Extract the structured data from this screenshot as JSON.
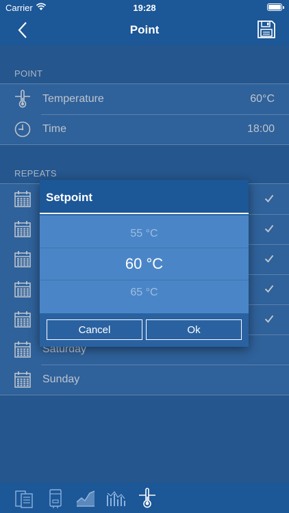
{
  "status_bar": {
    "carrier": "Carrier",
    "time": "19:28"
  },
  "nav": {
    "title": "Point",
    "back_icon": "chevron-left-icon",
    "save_icon": "floppy-disk-icon"
  },
  "point_section": {
    "header": "POINT",
    "rows": [
      {
        "label": "Temperature",
        "value": "60°C",
        "icon": "thermometer-icon"
      },
      {
        "label": "Time",
        "value": "18:00",
        "icon": "clock-icon"
      }
    ]
  },
  "repeats_section": {
    "header": "REPEATS",
    "rows": [
      {
        "label": "",
        "checked": true
      },
      {
        "label": "",
        "checked": true
      },
      {
        "label": "",
        "checked": true
      },
      {
        "label": "",
        "checked": true
      },
      {
        "label": "",
        "checked": true
      },
      {
        "label": "Saturday",
        "checked": false
      },
      {
        "label": "Sunday",
        "checked": false
      }
    ]
  },
  "dialog": {
    "title": "Setpoint",
    "options": [
      "55 °C",
      "60 °C",
      "65 °C"
    ],
    "selected": "60 °C",
    "cancel_label": "Cancel",
    "ok_label": "Ok"
  },
  "tabs": [
    "devices-icon",
    "boiler-icon",
    "area-chart-icon",
    "bar-chart-icon",
    "thermometer-icon"
  ],
  "colors": {
    "background": "#2d67a6",
    "bar": "#1c5797",
    "row": "#3b77b7",
    "picker": "#4a86c7"
  }
}
